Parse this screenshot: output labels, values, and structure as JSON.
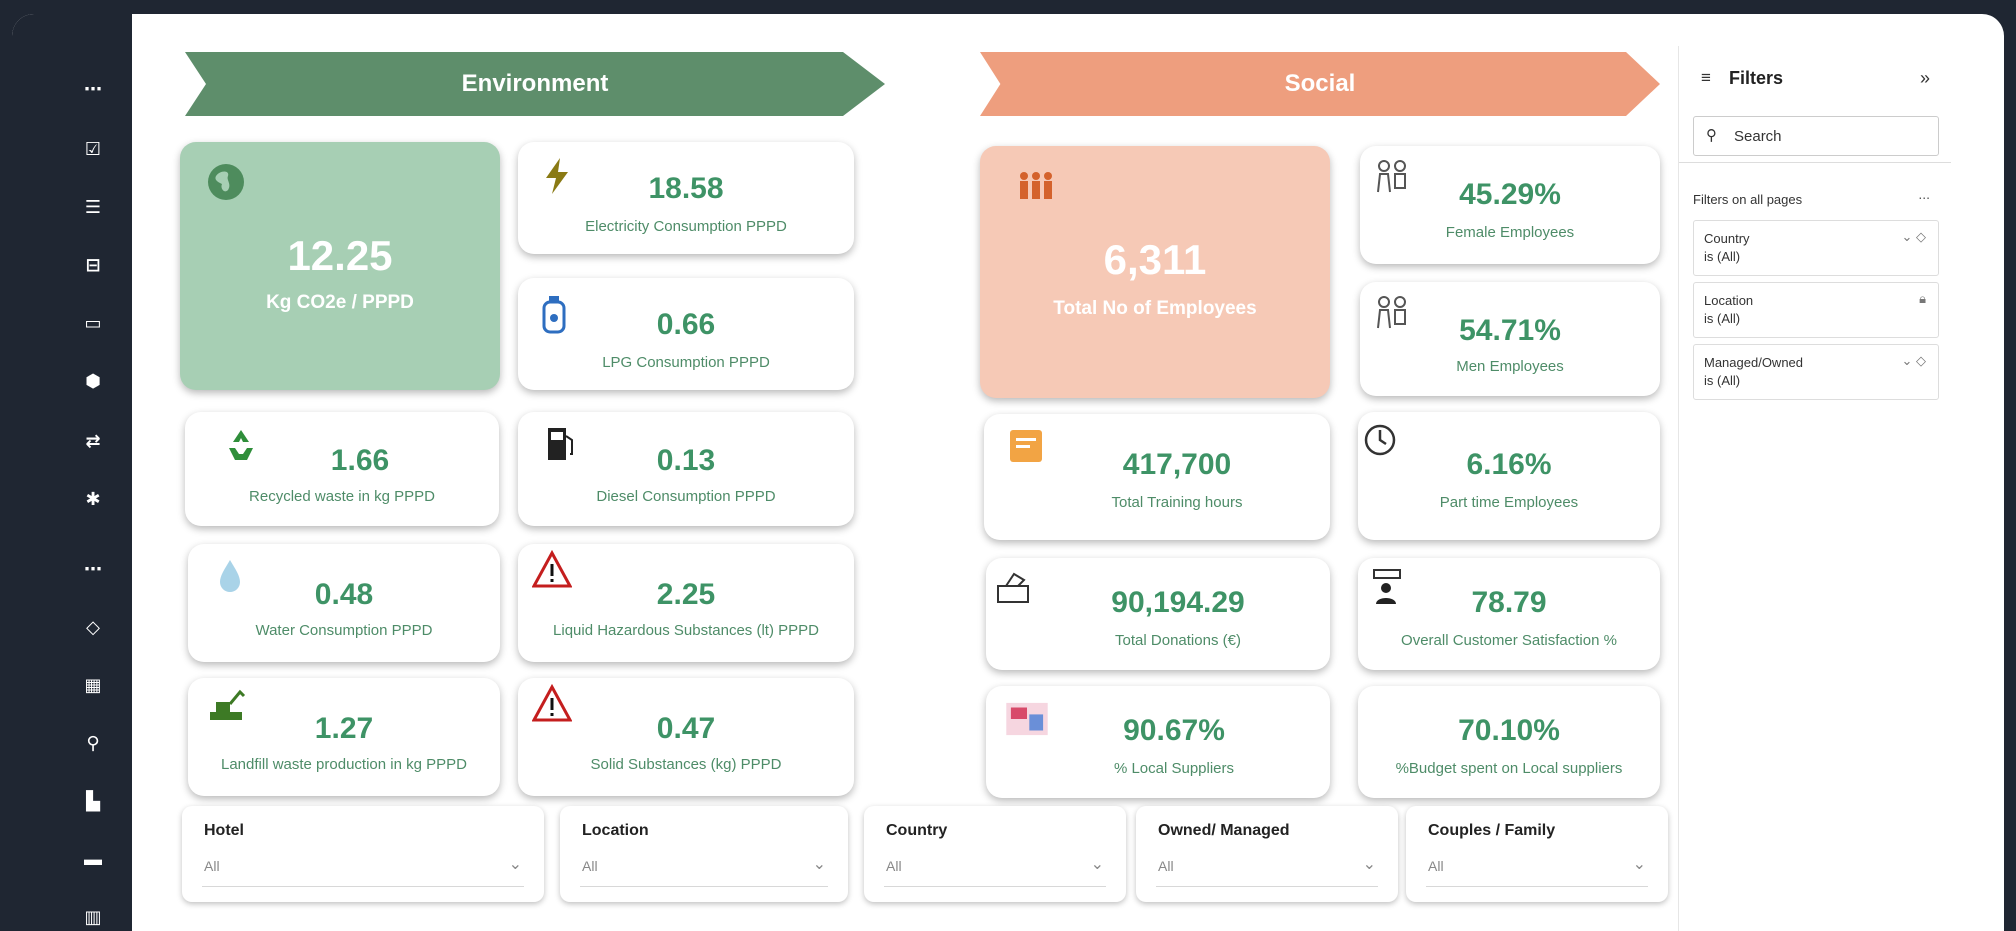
{
  "nav": {
    "icons": [
      "more-icon",
      "checkbox-icon",
      "list-icon",
      "import-icon",
      "folder-icon",
      "cube-icon",
      "arrows-icon",
      "gear-icon",
      "more-icon",
      "diamond-icon",
      "grid-icon",
      "pin-icon",
      "building-icon",
      "archive-icon",
      "book-icon"
    ]
  },
  "banners": {
    "environment": "Environment",
    "social": "Social"
  },
  "env": {
    "co2": {
      "value": "12.25",
      "label": "Kg CO2e / PPPD"
    },
    "electricity": {
      "value": "18.58",
      "label": "Electricity Consumption PPPD"
    },
    "lpg": {
      "value": "0.66",
      "label": "LPG Consumption PPPD"
    },
    "recycled": {
      "value": "1.66",
      "label": "Recycled waste in kg PPPD"
    },
    "diesel": {
      "value": "0.13",
      "label": "Diesel Consumption PPPD"
    },
    "water": {
      "value": "0.48",
      "label": "Water Consumption PPPD"
    },
    "liquid": {
      "value": "2.25",
      "label": "Liquid Hazardous Substances (lt) PPPD"
    },
    "landfill": {
      "value": "1.27",
      "label": "Landfill waste production in kg PPPD"
    },
    "solid": {
      "value": "0.47",
      "label": "Solid Substances (kg) PPPD"
    }
  },
  "soc": {
    "employees": {
      "value": "6,311",
      "label": "Total No of Employees"
    },
    "female": {
      "value": "45.29%",
      "label": "Female Employees"
    },
    "men": {
      "value": "54.71%",
      "label": "Men Employees"
    },
    "training": {
      "value": "417,700",
      "label": "Total Training hours"
    },
    "parttime": {
      "value": "6.16%",
      "label": "Part time Employees"
    },
    "donations": {
      "value": "90,194.29",
      "label": "Total Donations (€)"
    },
    "satisfaction": {
      "value": "78.79",
      "label": "Overall Customer Satisfaction %"
    },
    "local": {
      "value": "90.67%",
      "label": "% Local Suppliers"
    },
    "budget": {
      "value": "70.10%",
      "label": "%Budget spent on Local suppliers"
    }
  },
  "slicers": [
    {
      "title": "Hotel",
      "value": "All"
    },
    {
      "title": "Location",
      "value": "All"
    },
    {
      "title": "Country",
      "value": "All"
    },
    {
      "title": "Owned/ Managed",
      "value": "All"
    },
    {
      "title": "Couples / Family",
      "value": "All"
    }
  ],
  "filters": {
    "title": "Filters",
    "search_placeholder": "Search",
    "section": "Filters on all pages",
    "more": "...",
    "collapse": "»",
    "items": [
      {
        "title": "Country",
        "value": "is (All)"
      },
      {
        "title": "Location",
        "value": "is (All)"
      },
      {
        "title": "Managed/Owned",
        "value": "is (All)"
      }
    ]
  },
  "colors": {
    "env_accent": "#5e8e6b",
    "soc_accent": "#ee9e7e",
    "value_green": "#3e9366"
  }
}
